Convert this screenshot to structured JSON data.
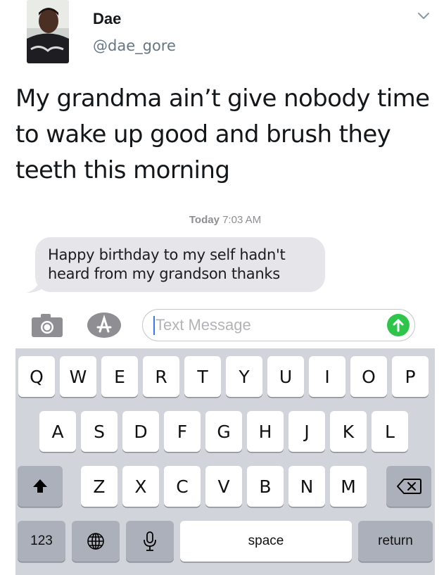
{
  "tweet": {
    "display_name": "Dae",
    "handle": "@dae_gore",
    "text": "My grandma ain’t give nobody time to wake up good and brush they teeth this morning"
  },
  "messages": {
    "timestamp_day": "Today",
    "timestamp_time": "7:03 AM",
    "bubble_text": "Happy birthday to  my self  hadn't heard from my grandson  thanks",
    "input_placeholder": "Text Message"
  },
  "keyboard": {
    "row1": [
      "Q",
      "W",
      "E",
      "R",
      "T",
      "Y",
      "U",
      "I",
      "O",
      "P"
    ],
    "row2": [
      "A",
      "S",
      "D",
      "F",
      "G",
      "H",
      "J",
      "K",
      "L"
    ],
    "row3": [
      "Z",
      "X",
      "C",
      "V",
      "B",
      "N",
      "M"
    ],
    "numbers_label": "123",
    "space_label": "space",
    "return_label": "return"
  },
  "icons": {
    "avatar": "profile-photo",
    "caret": "chevron-down-icon",
    "camera": "camera-icon",
    "appstore": "app-store-icon",
    "send": "arrow-up-icon",
    "shift": "shift-arrow-icon",
    "delete": "backspace-icon",
    "globe": "globe-icon",
    "mic": "microphone-icon"
  },
  "colors": {
    "bubble": "#e5e5ea",
    "send_button": "#2fc54a",
    "keyboard_bg": "#d1d4da",
    "handle": "#657786"
  }
}
